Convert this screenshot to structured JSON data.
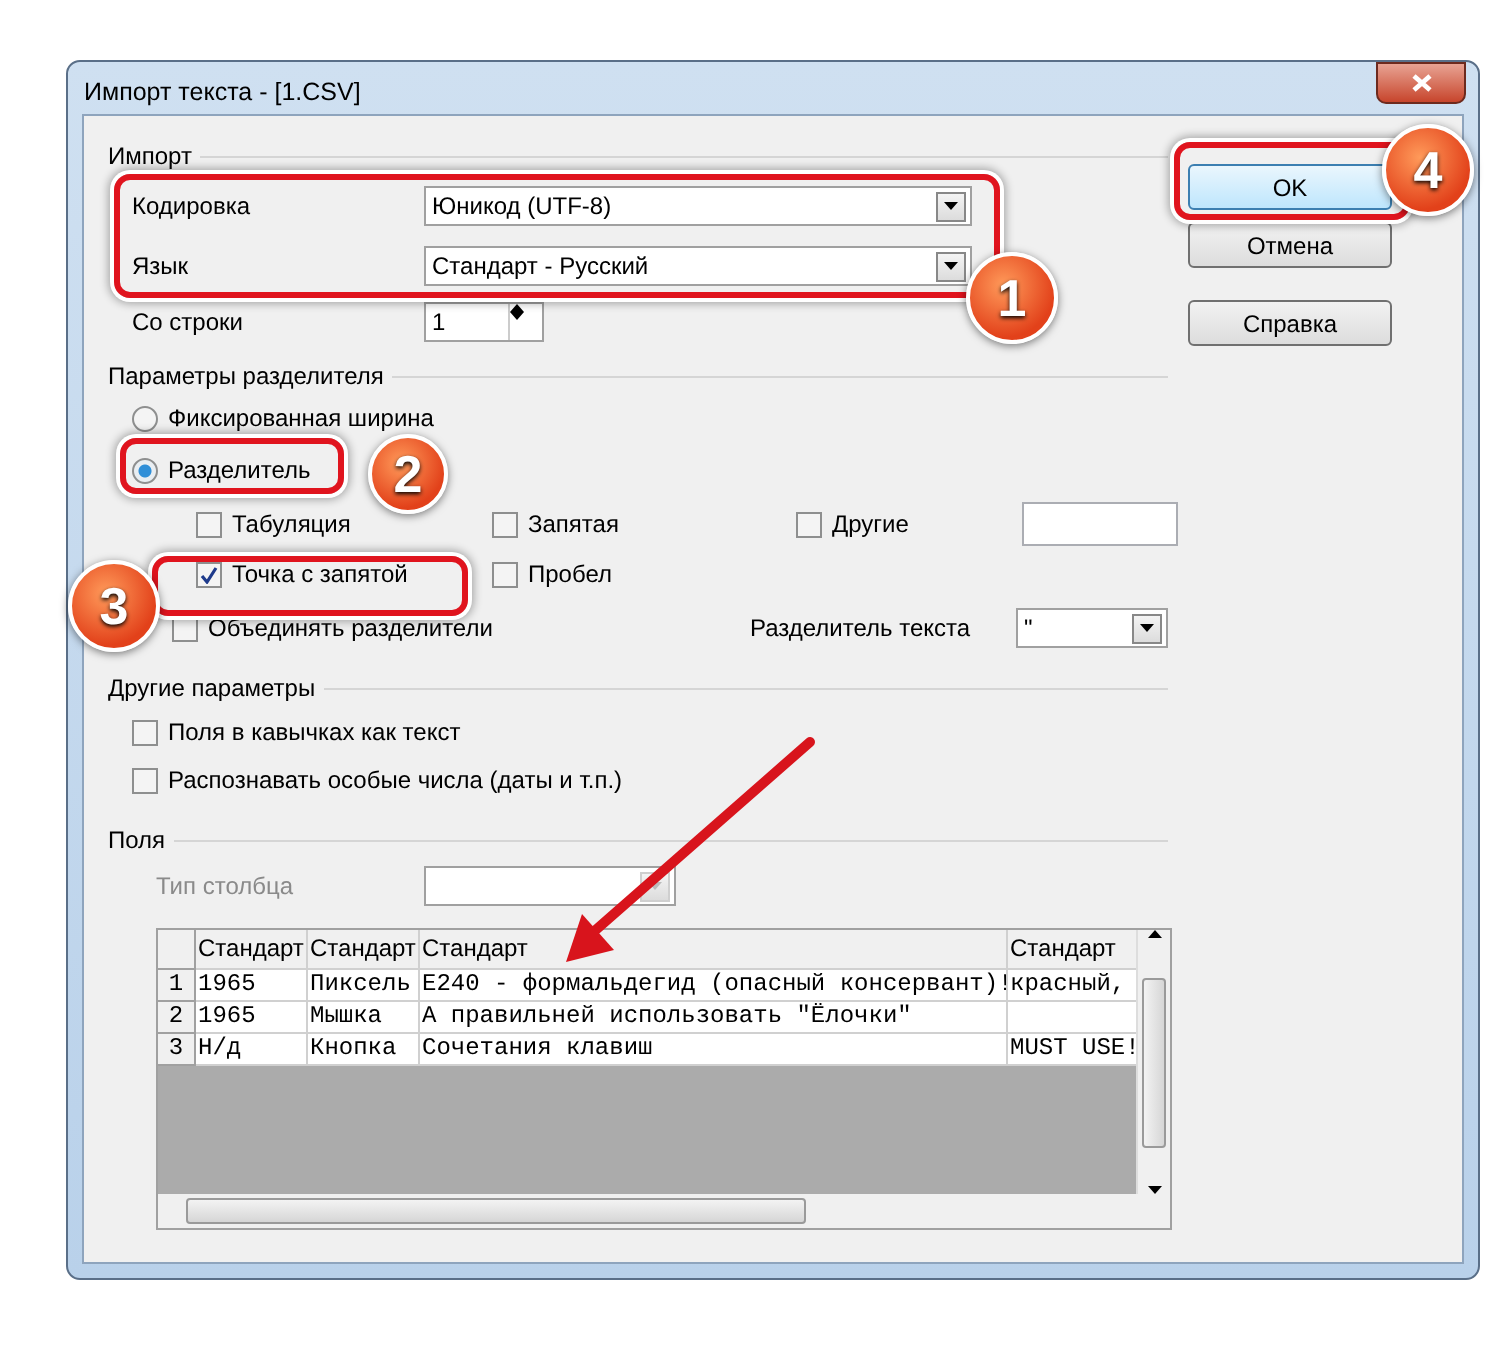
{
  "window": {
    "title": "Импорт текста - [1.CSV]"
  },
  "import": {
    "heading": "Импорт",
    "encoding": {
      "label": "Кодировка",
      "value": "Юникод (UTF-8)"
    },
    "language": {
      "label": "Язык",
      "value": "Стандарт - Русский"
    },
    "from_row": {
      "label": "Со строки",
      "value": "1"
    }
  },
  "separator_options": {
    "heading": "Параметры разделителя",
    "modes": [
      {
        "label": "Фиксированная ширина",
        "selected": false
      },
      {
        "label": "Разделитель",
        "selected": true
      }
    ],
    "separators": [
      {
        "label": "Табуляция",
        "checked": false
      },
      {
        "label": "Запятая",
        "checked": false
      },
      {
        "label": "Другие",
        "checked": false
      },
      {
        "label": "Точка с запятой",
        "checked": true
      },
      {
        "label": "Пробел",
        "checked": false
      }
    ],
    "merge": {
      "label": "Объединять разделители",
      "checked": false
    },
    "text_delimiter": {
      "label": "Разделитель текста",
      "value": "\""
    }
  },
  "other_options": {
    "heading": "Другие параметры",
    "options": [
      {
        "label": "Поля в кавычках как текст",
        "checked": false
      },
      {
        "label": "Распознавать особые числа (даты и т.п.)",
        "checked": false
      }
    ]
  },
  "fields": {
    "heading": "Поля",
    "column_type": {
      "label": "Тип столбца",
      "disabled": true
    },
    "table": {
      "columns": [
        "Стандарт",
        "Стандарт",
        "Стандарт",
        "Стандарт"
      ],
      "rows": [
        {
          "number": "1",
          "cells": [
            "1965",
            "Пиксель",
            "E240 - формальдегид (опасный консервант)!",
            "красный,"
          ]
        },
        {
          "number": "2",
          "cells": [
            "1965",
            "Мышка",
            "А правильней использовать \"Ёлочки\""
          ]
        },
        {
          "number": "3",
          "cells": [
            "Н/д",
            "Кнопка",
            "Сочетания клавиш",
            "MUST USE!"
          ]
        }
      ]
    }
  },
  "buttons": [
    {
      "label": "OK",
      "default": true
    },
    {
      "label": "Отмена",
      "default": false
    },
    {
      "label": "Справка",
      "default": false
    }
  ],
  "callouts": [
    {
      "number": "1"
    },
    {
      "number": "2"
    },
    {
      "number": "3"
    },
    {
      "number": "4"
    }
  ]
}
